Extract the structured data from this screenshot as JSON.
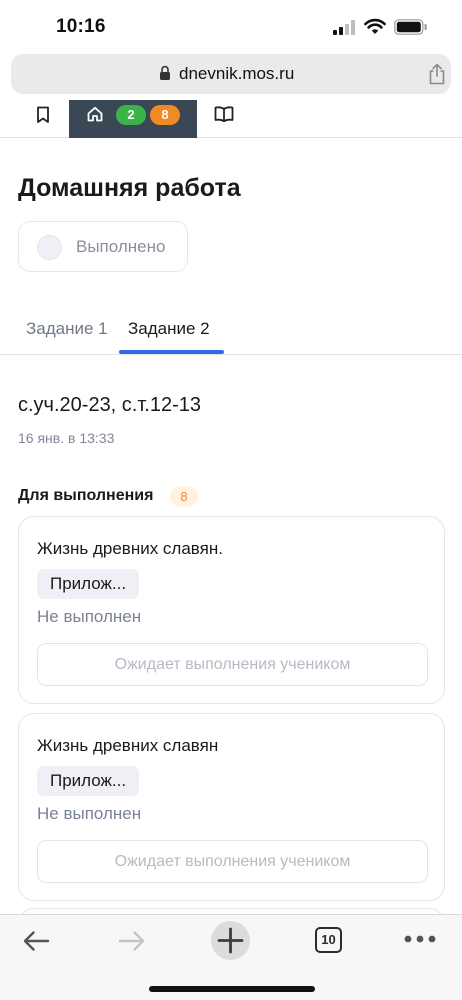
{
  "status_bar": {
    "time": "10:16"
  },
  "browser": {
    "url": "dnevnik.mos.ru",
    "tab_count": "10"
  },
  "top_nav": {
    "badge_green": "2",
    "badge_orange": "8"
  },
  "page": {
    "title": "Домашняя работа",
    "done_label": "Выполнено",
    "tabs": [
      {
        "label": "Задание 1",
        "active": false
      },
      {
        "label": "Задание 2",
        "active": true
      }
    ],
    "task_text": "с.уч.20-23, с.т.12-13",
    "task_date": "16 янв. в 13:33",
    "section_title": "Для выполнения",
    "section_count": "8",
    "cards": [
      {
        "title": "Жизнь древних славян.",
        "attachment": "Прилож...",
        "status": "Не выполнен",
        "button": "Ожидает выполнения учеником"
      },
      {
        "title": "Жизнь древних славян",
        "attachment": "Прилож...",
        "status": "Не выполнен",
        "button": "Ожидает выполнения учеником"
      }
    ]
  },
  "colors": {
    "accent": "#2f6ee0",
    "nav_dark": "#3a4754",
    "badge_green": "#3ab449",
    "badge_orange": "#f08a24"
  }
}
